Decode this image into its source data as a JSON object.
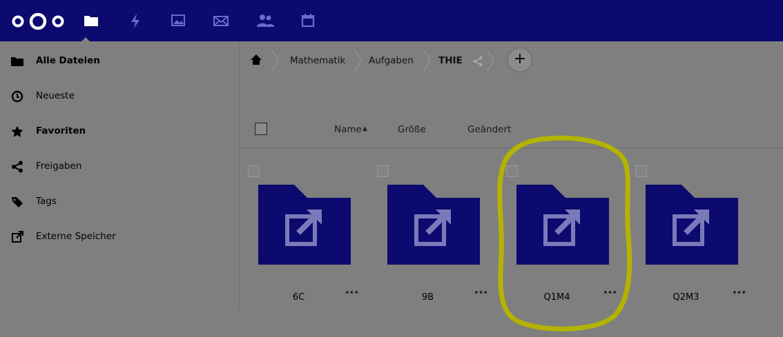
{
  "topbar": {
    "icons": [
      "logo-icon",
      "files-icon",
      "activity-icon",
      "gallery-icon",
      "mail-icon",
      "contacts-icon",
      "calendar-icon"
    ],
    "color": "#0c0a6e"
  },
  "sidebar": {
    "items": [
      {
        "label": "Alle Dateien",
        "icon": "folder-icon",
        "active": true
      },
      {
        "label": "Neueste",
        "icon": "clock-icon"
      },
      {
        "label": "Favoriten",
        "icon": "star-icon"
      },
      {
        "label": "Freigaben",
        "icon": "share-icon"
      },
      {
        "label": "Tags",
        "icon": "tag-icon"
      },
      {
        "label": "Externe Speicher",
        "icon": "external-link-icon"
      }
    ]
  },
  "breadcrumb": {
    "items": [
      "Mathematik",
      "Aufgaben",
      "THIE"
    ],
    "add_label": "+"
  },
  "columns": {
    "name": "Name",
    "sort_indicator": "▲",
    "size": "Größe",
    "modified": "Geändert"
  },
  "files": [
    {
      "name": "6C",
      "more": "•••"
    },
    {
      "name": "9B",
      "more": "•••"
    },
    {
      "name": "Q1M4",
      "more": "•••",
      "highlighted": true
    },
    {
      "name": "Q2M3",
      "more": "•••"
    }
  ],
  "colors": {
    "folder": "#0c0a6e",
    "highlight": "#b3b300",
    "overlay_background": "#7f7f7f"
  }
}
